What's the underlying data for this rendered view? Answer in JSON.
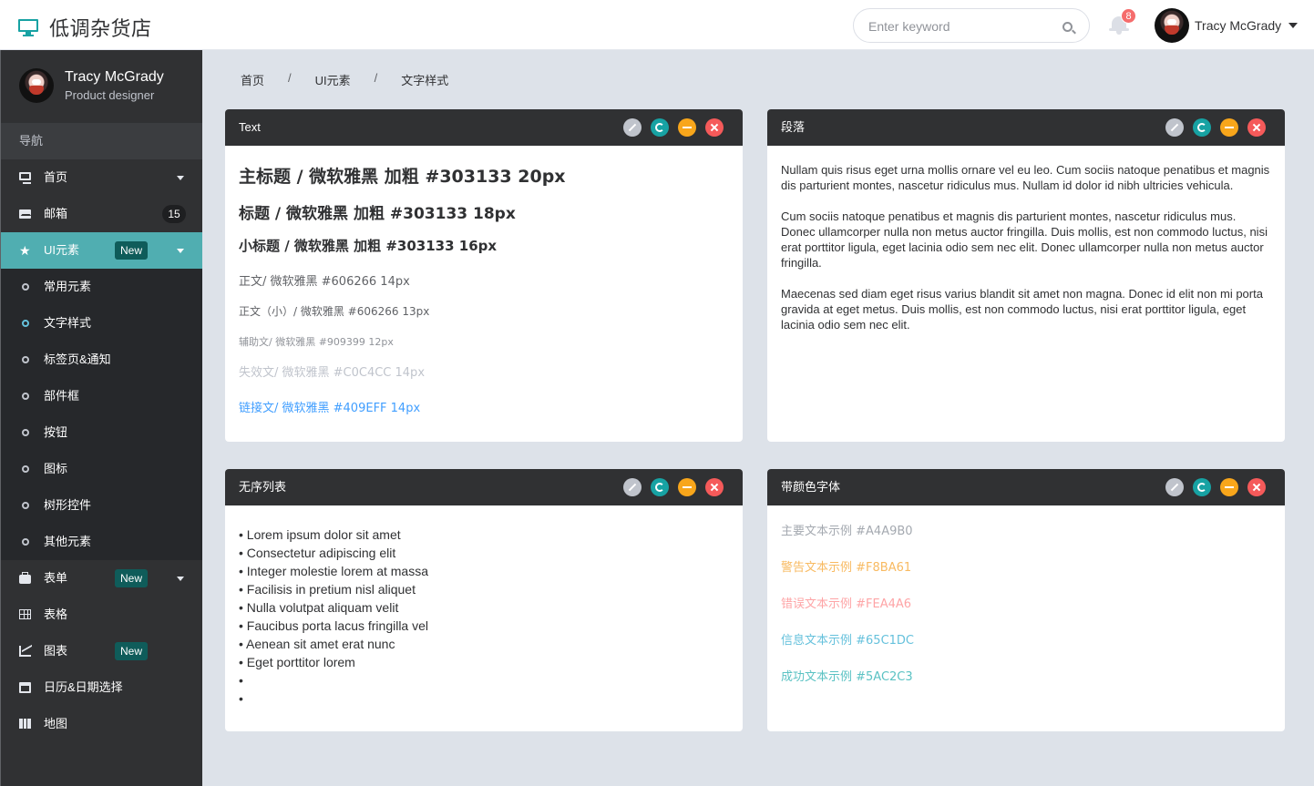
{
  "header": {
    "brand": "低调杂货店",
    "search_placeholder": "Enter keyword",
    "notification_count": "8",
    "user_name": "Tracy McGrady"
  },
  "sidebar": {
    "profile_name": "Tracy McGrady",
    "profile_role": "Product designer",
    "nav_heading": "导航",
    "items": [
      {
        "label": "首页",
        "icon": "monitor-icon"
      },
      {
        "label": "邮箱",
        "icon": "mail-icon",
        "count": "15"
      },
      {
        "label": "UI元素",
        "icon": "star-icon",
        "tag": "New"
      },
      {
        "label": "表单",
        "icon": "briefcase-icon",
        "tag": "New"
      },
      {
        "label": "表格",
        "icon": "table-icon"
      },
      {
        "label": "图表",
        "icon": "line-chart-icon",
        "tag": "New"
      },
      {
        "label": "日历&日期选择",
        "icon": "calendar-icon"
      },
      {
        "label": "地图",
        "icon": "map-icon"
      }
    ],
    "sub_items": [
      "常用元素",
      "文字样式",
      "标签页&通知",
      "部件框",
      "按钮",
      "图标",
      "树形控件",
      "其他元素"
    ]
  },
  "breadcrumb": [
    "首页",
    "UI元素",
    "文字样式"
  ],
  "breadcrumb_sep": "/",
  "panels": {
    "text": {
      "title": "Text",
      "h1": "主标题 / 微软雅黑 加粗 #303133 20px",
      "h2": "标题 / 微软雅黑 加粗 #303133 18px",
      "h3": "小标题 / 微软雅黑 加粗 #303133 16px",
      "body": "正文/ 微软雅黑  #606266 14px",
      "body_small": "正文（小）/ 微软雅黑  #606266 13px",
      "aux": "辅助文/ 微软雅黑  #909399 12px",
      "disabled": "失效文/ 微软雅黑  #C0C4CC 14px",
      "link": "链接文/ 微软雅黑  #409EFF 14px"
    },
    "paragraph": {
      "title": "段落",
      "paragraphs": [
        "Nullam quis risus eget urna mollis ornare vel eu leo. Cum sociis natoque penatibus et magnis dis parturient montes, nascetur ridiculus mus. Nullam id dolor id nibh ultricies vehicula.",
        "Cum sociis natoque penatibus et magnis dis parturient montes, nascetur ridiculus mus. Donec ullamcorper nulla non metus auctor fringilla. Duis mollis, est non commodo luctus, nisi erat porttitor ligula, eget lacinia odio sem nec elit. Donec ullamcorper nulla non metus auctor fringilla.",
        "Maecenas sed diam eget risus varius blandit sit amet non magna. Donec id elit non mi porta gravida at eget metus. Duis mollis, est non commodo luctus, nisi erat porttitor ligula, eget lacinia odio sem nec elit."
      ]
    },
    "list": {
      "title": "无序列表",
      "items": [
        "Lorem ipsum dolor sit amet",
        "Consectetur adipiscing elit",
        "Integer molestie lorem at massa",
        "Facilisis in pretium nisl aliquet",
        "Nulla volutpat aliquam velit",
        "Faucibus porta lacus fringilla vel",
        "Aenean sit amet erat nunc",
        "Eget porttitor lorem",
        "",
        ""
      ]
    },
    "colored": {
      "title": "带颜色字体",
      "items": [
        {
          "text": "主要文本示例 #A4A9B0",
          "color": "#A4A9B0"
        },
        {
          "text": "警告文本示例 #F8BA61",
          "color": "#F8BA61"
        },
        {
          "text": "错误文本示例 #FEA4A6",
          "color": "#FEA4A6"
        },
        {
          "text": "信息文本示例 #65C1DC",
          "color": "#65C1DC"
        },
        {
          "text": "成功文本示例 #5AC2C3",
          "color": "#5AC2C3"
        }
      ]
    }
  }
}
